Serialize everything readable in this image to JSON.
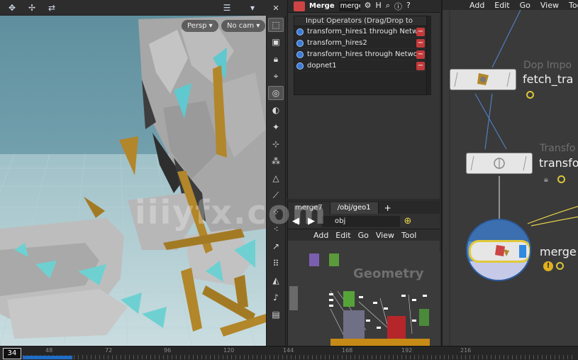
{
  "viewport": {
    "camera_menu": "Persp",
    "camera_target_menu": "No cam",
    "background_color": "#3a3a3a"
  },
  "param_panel": {
    "node_type": "Merge",
    "node_name": "merge",
    "list_header": "Input Operators (Drag/Drop to",
    "operators": [
      "transform_hires1 through Netwo",
      "transform_hires2",
      "transform_hires through Networ",
      "dopnet1"
    ]
  },
  "network_pane": {
    "tabs": [
      "merge7",
      "/obj/geo1"
    ],
    "path": "obj",
    "menu": [
      "Add",
      "Edit",
      "Go",
      "View",
      "Tool"
    ],
    "context_label": "Geometry"
  },
  "network_editor": {
    "menu": [
      "Add",
      "Edit",
      "Go",
      "View",
      "Too"
    ],
    "nodes": [
      {
        "type_label": "Dop Impo",
        "name": "fetch_tra"
      },
      {
        "type_label": "Transfo",
        "name": "transfo"
      },
      {
        "type_label": "",
        "name": "merge"
      }
    ]
  },
  "timeline": {
    "current_frame": "34",
    "tick_labels": [
      "48",
      "72",
      "96",
      "120",
      "144",
      "168",
      "192",
      "216"
    ]
  },
  "watermark": "iiiyfx.com",
  "colors": {
    "accent_blue": "#1f6cc7",
    "node_ring_yellow": "#e0c93a",
    "shard_teal": "#6fd0d2",
    "shard_gold": "#b2862a"
  }
}
